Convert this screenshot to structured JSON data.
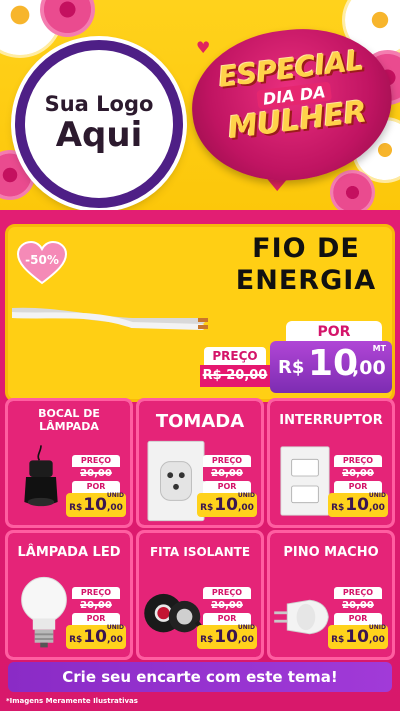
{
  "logo": {
    "line1": "Sua Logo",
    "line2": "Aqui"
  },
  "title": {
    "especial": "ESPECIAL",
    "dia_da": "DIA DA",
    "mulher": "MULHER"
  },
  "hero": {
    "discount": "-50%",
    "product": "FIO DE ENERGIA",
    "preco_label": "PREÇO",
    "old_price": "R$ 20,00",
    "por_label": "POR",
    "currency": "R$",
    "price_int": "10",
    "price_dec": ",00",
    "unit": "MT"
  },
  "products": [
    {
      "name": "BOCAL DE LÂMPADA",
      "preco_label": "PREÇO",
      "old_price": "20,00",
      "por_label": "POR",
      "currency": "R$",
      "price_int": "10",
      "price_dec": ",00",
      "unit": "UNID"
    },
    {
      "name": "TOMADA",
      "preco_label": "PREÇO",
      "old_price": "20,00",
      "por_label": "POR",
      "currency": "R$",
      "price_int": "10",
      "price_dec": ",00",
      "unit": "UNID"
    },
    {
      "name": "INTERRUPTOR",
      "preco_label": "PREÇO",
      "old_price": "20,00",
      "por_label": "POR",
      "currency": "R$",
      "price_int": "10",
      "price_dec": ",00",
      "unit": "UNID"
    },
    {
      "name": "LÂMPADA LED",
      "preco_label": "PREÇO",
      "old_price": "20,00",
      "por_label": "POR",
      "currency": "R$",
      "price_int": "10",
      "price_dec": ",00",
      "unit": "UNID"
    },
    {
      "name": "FITA ISOLANTE",
      "preco_label": "PREÇO",
      "old_price": "20,00",
      "por_label": "POR",
      "currency": "R$",
      "price_int": "10",
      "price_dec": ",00",
      "unit": "UNID"
    },
    {
      "name": "PINO MACHO",
      "preco_label": "PREÇO",
      "old_price": "20,00",
      "por_label": "POR",
      "currency": "R$",
      "price_int": "10",
      "price_dec": ",00",
      "unit": "UNID"
    }
  ],
  "cta": "Crie seu encarte com este tema!",
  "footnote": "*Imagens Meramente Ilustrativas",
  "colors": {
    "yellow": "#ffd21c",
    "pink": "#e21e73",
    "purple": "#4e1f86",
    "violet": "#9a38d2"
  }
}
